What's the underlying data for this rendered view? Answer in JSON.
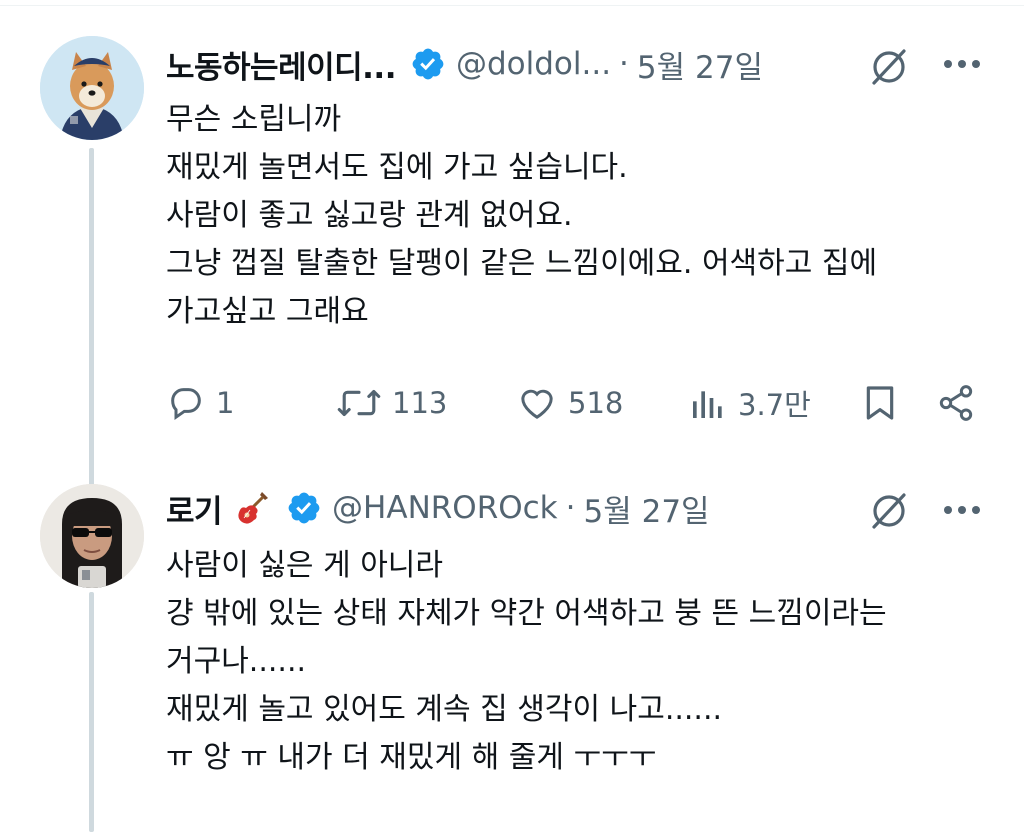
{
  "tweets": [
    {
      "name": "노동하는레이디...",
      "handle": "@doldol...",
      "separator": "·",
      "date": "5월 27일",
      "avatar_icon": "shiba-dog-avatar",
      "verified_color": "#1d9bf0",
      "lines": [
        "무슨 소립니까",
        "재밌게 놀면서도 집에 가고 싶습니다.",
        "사람이 좋고 싫고랑 관계 없어요.",
        "그냥 껍질 탈출한 달팽이 같은 느낌이에요. 어색하고 집에",
        "가고싶고 그래요"
      ],
      "actions": {
        "replies": "1",
        "retweets": "113",
        "likes": "518",
        "views": "3.7만"
      }
    },
    {
      "name": "로기",
      "name_emoji": "guitar-icon",
      "handle": "@HANROROck",
      "separator": "·",
      "date": "5월 27일",
      "avatar_icon": "person-sunglasses-avatar",
      "verified_color": "#1d9bf0",
      "lines": [
        "사람이 싫은 게 아니라",
        "걍 밖에 있는 상태 자체가 약간 어색하고 붕 뜬 느낌이라는",
        "거구나......",
        "재밌게 놀고 있어도 계속 집 생각이 나고......",
        "ㅠ 앙 ㅠ 내가 더 재밌게 해 줄게 ㅜㅜㅜ"
      ]
    }
  ]
}
